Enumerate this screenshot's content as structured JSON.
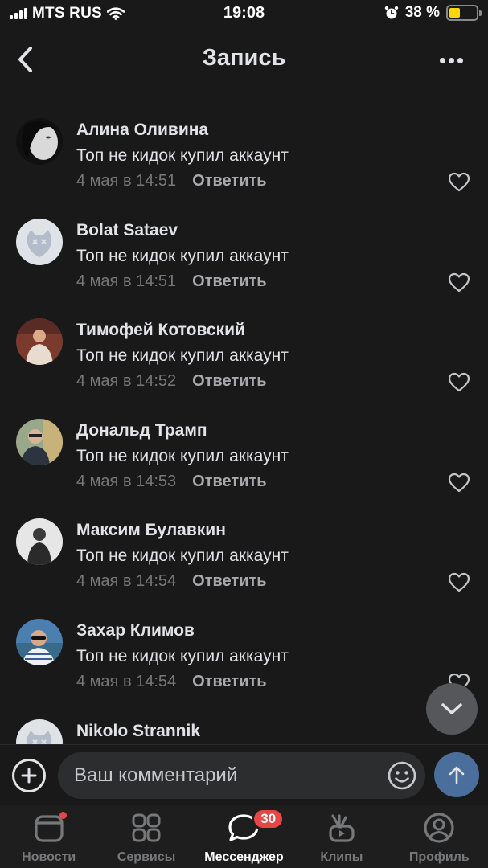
{
  "status_bar": {
    "carrier": "MTS RUS",
    "time": "19:08",
    "battery": "38 %"
  },
  "header": {
    "title": "Запись"
  },
  "comments": [
    {
      "name": "Алина Оливина",
      "text": "Топ не кидок купил аккаунт",
      "date": "4 мая в 14:51",
      "reply": "Ответить"
    },
    {
      "name": "Bolat Sataev",
      "text": "Топ не кидок купил аккаунт",
      "date": "4 мая в 14:51",
      "reply": "Ответить"
    },
    {
      "name": "Тимофей Котовский",
      "text": "Топ не кидок купил аккаунт",
      "date": "4 мая в 14:52",
      "reply": "Ответить"
    },
    {
      "name": "Дональд Трамп",
      "text": "Топ не кидок купил аккаунт",
      "date": "4 мая в 14:53",
      "reply": "Ответить"
    },
    {
      "name": "Максим Булавкин",
      "text": "Топ не кидок купил аккаунт",
      "date": "4 мая в 14:54",
      "reply": "Ответить"
    },
    {
      "name": "Захар Климов",
      "text": "Топ не кидок купил аккаунт",
      "date": "4 мая в 14:54",
      "reply": "Ответить"
    },
    {
      "name": "Nikolo Strannik",
      "text": "",
      "date": "",
      "reply": ""
    }
  ],
  "input": {
    "placeholder": "Ваш комментарий"
  },
  "tabs": [
    {
      "label": "Новости",
      "icon": "news-icon",
      "has_dot": true
    },
    {
      "label": "Сервисы",
      "icon": "services-icon"
    },
    {
      "label": "Мессенджер",
      "icon": "messenger-icon",
      "badge": "30",
      "active": true
    },
    {
      "label": "Клипы",
      "icon": "clips-icon"
    },
    {
      "label": "Профиль",
      "icon": "profile-icon"
    }
  ],
  "colors": {
    "background": "#19191a",
    "accent": "#4a6f9c",
    "badge": "#e64646",
    "secondary_text": "#76787a"
  }
}
